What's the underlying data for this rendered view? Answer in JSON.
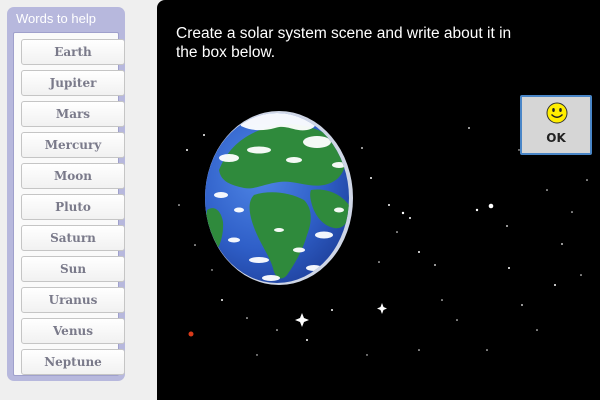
{
  "word_panel": {
    "title": "Words to help",
    "words": [
      "Earth",
      "Jupiter",
      "Mars",
      "Mercury",
      "Moon",
      "Pluto",
      "Saturn",
      "Sun",
      "Uranus",
      "Venus",
      "Neptune"
    ]
  },
  "stage": {
    "instructions": "Create a solar system scene and write about it in the box below.",
    "planet_icon": "earth-planet",
    "background_color": "#000000"
  },
  "ok_button": {
    "label": "OK",
    "icon": "smiley-face-icon",
    "border_color": "#4a86c7"
  },
  "colors": {
    "panel": "#b7b8dd",
    "ocean": "#2f5fc8",
    "land": "#2f8a3c",
    "smiley": "#ffee00"
  }
}
